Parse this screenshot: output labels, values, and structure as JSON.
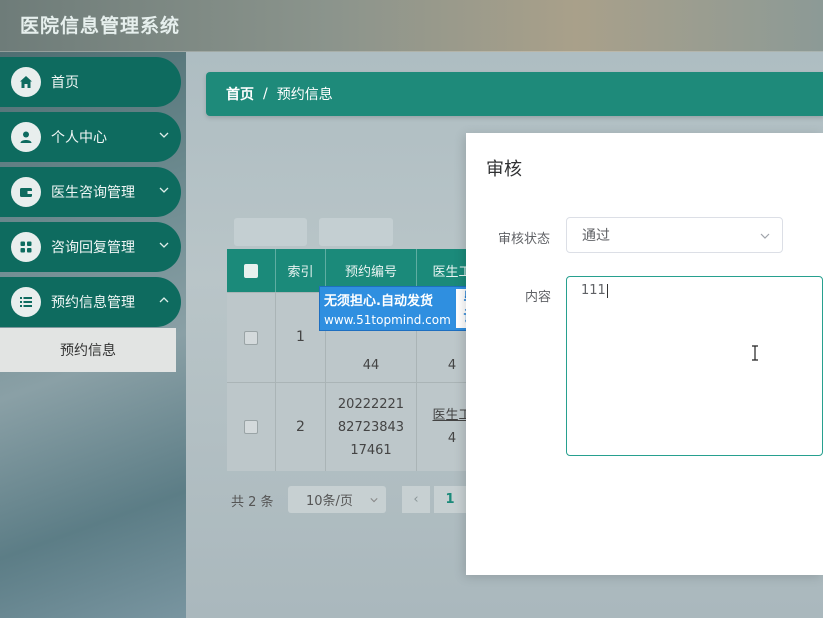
{
  "app": {
    "title": "医院信息管理系统"
  },
  "sidebar": {
    "items": [
      {
        "label": "首页",
        "icon": "home-icon",
        "has_chevron": false
      },
      {
        "label": "个人中心",
        "icon": "user-icon",
        "has_chevron": true
      },
      {
        "label": "医生咨询管理",
        "icon": "wallet-icon",
        "has_chevron": true
      },
      {
        "label": "咨询回复管理",
        "icon": "grid-icon",
        "has_chevron": true
      },
      {
        "label": "预约信息管理",
        "icon": "list-icon",
        "has_chevron": true
      }
    ],
    "sub_item": "预约信息"
  },
  "breadcrumb": {
    "home": "首页",
    "separator": "/",
    "current": "预约信息"
  },
  "table": {
    "columns": [
      "索引",
      "预约编号",
      "医生工"
    ],
    "rows": [
      {
        "index": "1",
        "code": "44",
        "doctor": "4"
      },
      {
        "index": "2",
        "code_lines": [
          "20222221",
          "82723843",
          "17461"
        ],
        "doctor_link": "医生工",
        "doctor": "4"
      }
    ]
  },
  "pagination": {
    "total": "共 2 条",
    "page_size": "10条/页",
    "prev": "‹",
    "current_page": "1"
  },
  "dialog": {
    "title": "审核",
    "status_label": "审核状态",
    "status_value": "通过",
    "content_label": "内容",
    "content_value": "111"
  },
  "watermark": {
    "line1": "无须担心.自动发货",
    "line2": "www.51topmind.com",
    "badge_top": "毕业",
    "badge_bottom": "设计"
  },
  "colors": {
    "primary": "#1b8a7a",
    "sidebar_item": "#0e6b5f",
    "focus_border": "#27a08f"
  }
}
